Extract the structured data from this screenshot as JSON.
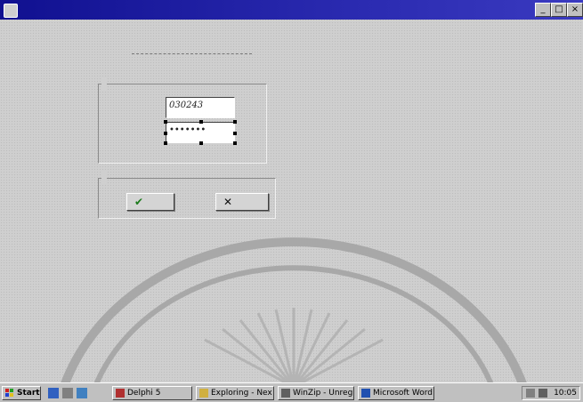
{
  "window": {
    "title": "",
    "buttons": {
      "minimize": "_",
      "maximize": "□",
      "close": "×"
    }
  },
  "form": {
    "heading": "",
    "login_group": {
      "label": "",
      "username_label": "",
      "username_value": "030243",
      "password_label": "",
      "password_value": "•••••••"
    },
    "confirm_group": {
      "label": "",
      "ok_button": "",
      "cancel_button": ""
    }
  },
  "taskbar": {
    "start_label": "Start",
    "tasks": [
      {
        "label": "Delphi 5"
      },
      {
        "label": "Exploring - Nex"
      },
      {
        "label": "WinZip - Unregist..."
      },
      {
        "label": "Microsoft Word"
      }
    ],
    "clock": "10:05"
  },
  "colors": {
    "titlebar": "#1a1a9a",
    "background": "#cfcfcf",
    "ok_check": "#1a7a1a"
  },
  "icons": [
    "window-app-icon",
    "check-icon",
    "cross-icon",
    "windows-logo-icon",
    "delphi-icon",
    "folder-icon",
    "winzip-icon",
    "word-icon",
    "emblem-watermark-icon"
  ]
}
